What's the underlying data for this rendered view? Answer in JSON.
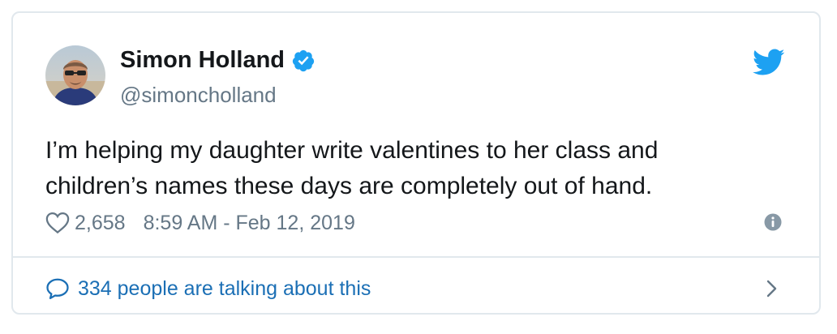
{
  "tweet": {
    "display_name": "Simon Holland",
    "handle": "@simoncholland",
    "text_line1": "I’m helping my daughter write valentines to her class and",
    "text_line2": "children’s names these days are completely out of hand.",
    "like_count": "2,658",
    "timestamp": "8:59 AM - Feb 12, 2019",
    "talking_about": "334 people are talking about this",
    "verified": true
  },
  "icons": {
    "verified": "verified-badge-icon",
    "twitter": "twitter-bird-icon",
    "like": "heart-icon",
    "info": "info-icon",
    "reply": "speech-bubble-icon",
    "chevron": "chevron-right-icon"
  },
  "colors": {
    "brand_blue": "#1da1f2",
    "link_blue": "#1b6fb5",
    "text": "#14171a",
    "muted": "#657786",
    "border": "#e1e8ed"
  }
}
